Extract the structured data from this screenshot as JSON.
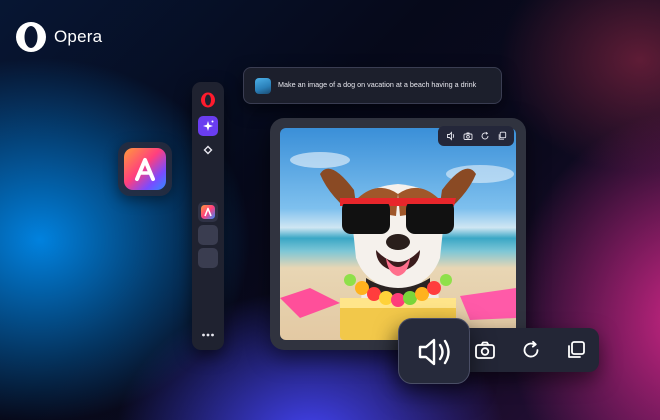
{
  "brand": {
    "name": "Opera",
    "logo_icon": "opera-o-icon"
  },
  "app_icon": {
    "icon": "aria-a-icon"
  },
  "sidebar": {
    "items": [
      {
        "icon": "opera-icon"
      },
      {
        "icon": "ai-sparkle-icon",
        "active": true
      },
      {
        "icon": "diamond-icon"
      },
      {
        "icon": "aria-icon"
      },
      {
        "icon": "empty-slot"
      },
      {
        "icon": "empty-slot"
      },
      {
        "icon": "more-icon"
      }
    ]
  },
  "prompt": {
    "text": "Make an image of a dog on vacation at a beach having a drink"
  },
  "image_panel": {
    "mini_toolbar": [
      "speaker-icon",
      "camera-icon",
      "refresh-icon",
      "copy-icon"
    ]
  },
  "toolbar": {
    "buttons": [
      "speaker-icon",
      "camera-icon",
      "refresh-icon",
      "copy-icon"
    ],
    "active": "speaker-icon"
  },
  "colors": {
    "accent": "#6a3df0",
    "brand_red": "#ff1b2d"
  }
}
